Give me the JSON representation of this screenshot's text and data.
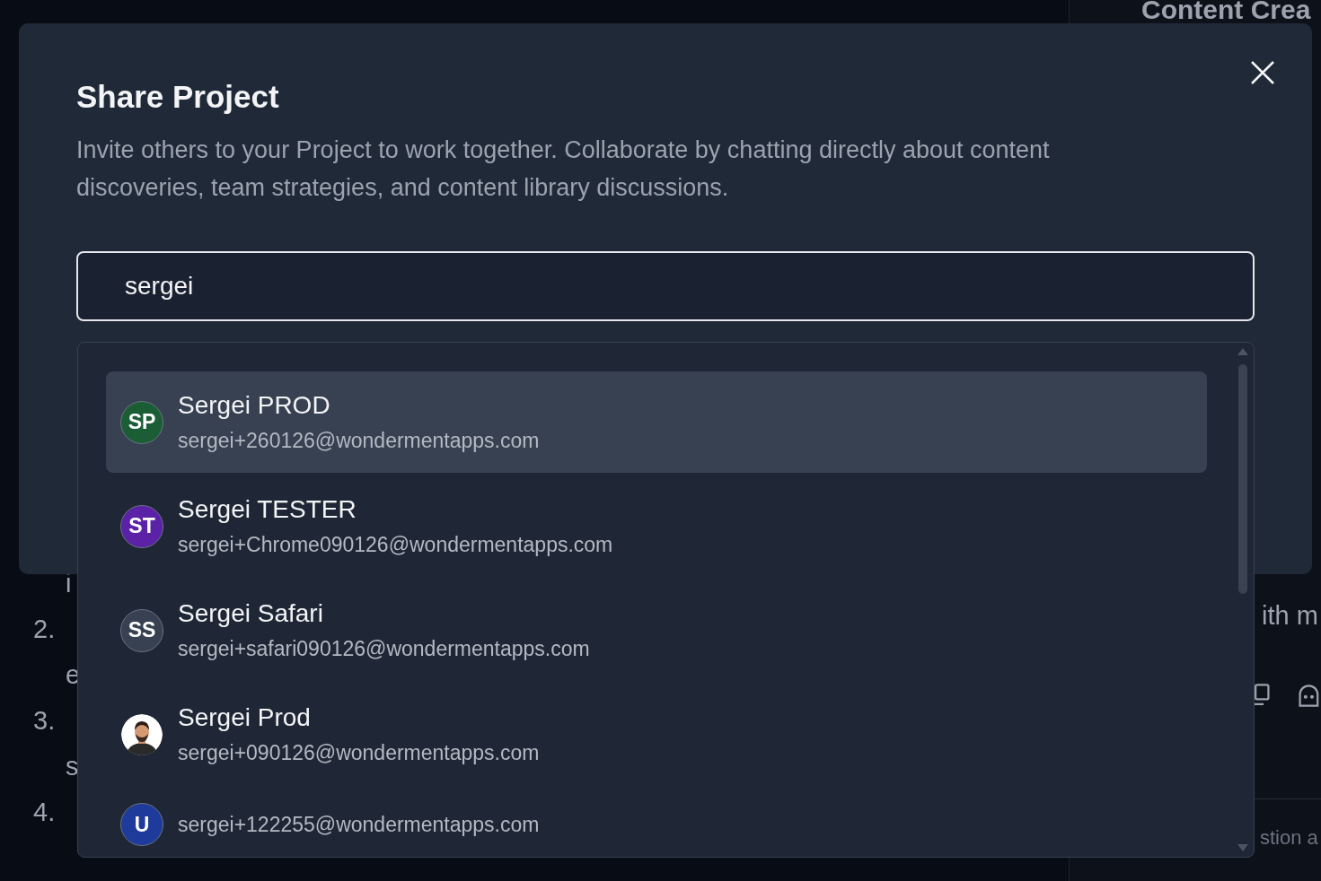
{
  "background": {
    "list_lines": [
      {
        "text": "i"
      },
      {
        "marker": "2."
      },
      {
        "text": "e"
      },
      {
        "marker": "3."
      },
      {
        "text": "s"
      },
      {
        "marker": "4."
      }
    ],
    "side_panel": {
      "title": "Content Crea",
      "lines": [
        "ith m"
      ],
      "input_placeholder": "stion a"
    }
  },
  "dialog": {
    "title": "Share Project",
    "description": "Invite others to your Project to work together. Collaborate by chatting directly about content discoveries, team strategies, and content library discussions.",
    "search": {
      "value": "sergei"
    },
    "results": [
      {
        "name": "Sergei PROD",
        "email": "sergei+260126@wondermentapps.com",
        "avatar": {
          "kind": "initials",
          "initials": "SP",
          "color": "#1b5e36"
        },
        "selected": true
      },
      {
        "name": "Sergei TESTER",
        "email": "sergei+Chrome090126@wondermentapps.com",
        "avatar": {
          "kind": "initials",
          "initials": "ST",
          "color": "#5b21a6"
        },
        "selected": false
      },
      {
        "name": "Sergei Safari",
        "email": "sergei+safari090126@wondermentapps.com",
        "avatar": {
          "kind": "initials",
          "initials": "SS",
          "color": "#374151"
        },
        "selected": false
      },
      {
        "name": "Sergei Prod",
        "email": "sergei+090126@wondermentapps.com",
        "selected": false
      },
      {
        "email": "sergei+122255@wondermentapps.com",
        "avatar": {
          "kind": "initials",
          "initials": "U",
          "color": "#1e3a9a"
        },
        "selected": false
      }
    ]
  }
}
